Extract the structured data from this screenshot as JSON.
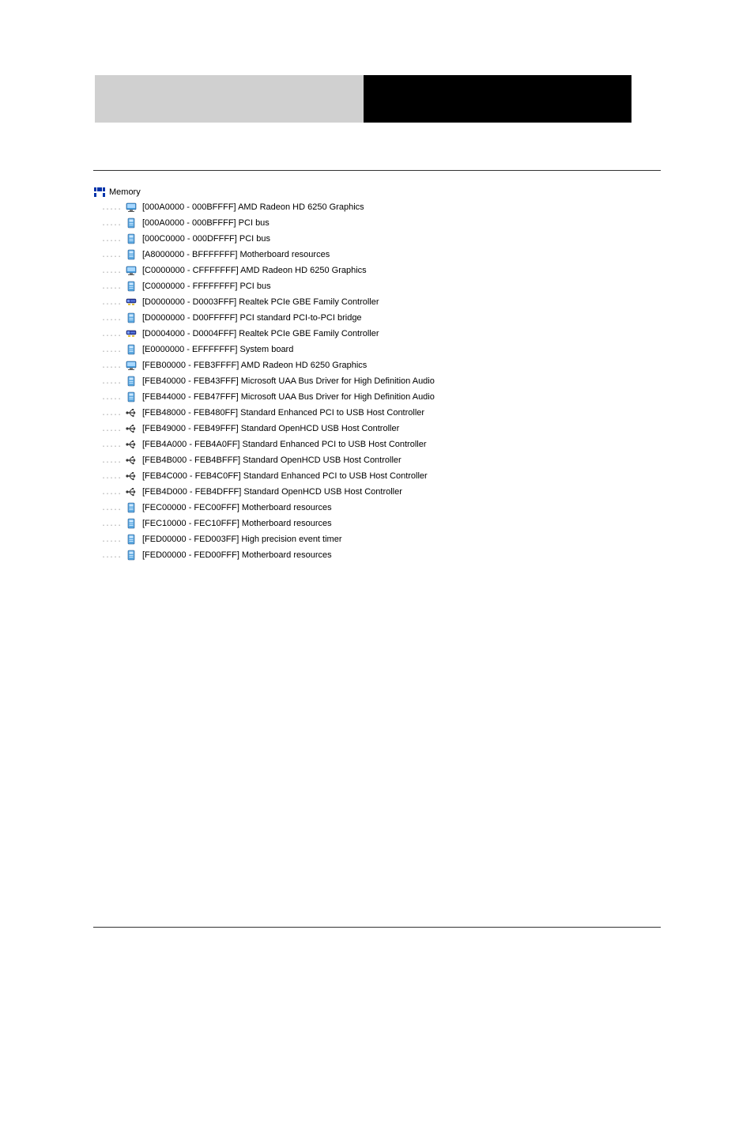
{
  "header": {
    "left": "",
    "right": ""
  },
  "tree": {
    "rootLabel": "Memory",
    "rootIcon": "memory-icon",
    "items": [
      {
        "icon": "display-icon",
        "text": "[000A0000 - 000BFFFF]  AMD Radeon HD 6250 Graphics"
      },
      {
        "icon": "system-icon",
        "text": "[000A0000 - 000BFFFF]  PCI bus"
      },
      {
        "icon": "system-icon",
        "text": "[000C0000 - 000DFFFF]  PCI bus"
      },
      {
        "icon": "system-icon",
        "text": "[A8000000 - BFFFFFFF]  Motherboard resources"
      },
      {
        "icon": "display-icon",
        "text": "[C0000000 - CFFFFFFF]  AMD Radeon HD 6250 Graphics"
      },
      {
        "icon": "system-icon",
        "text": "[C0000000 - FFFFFFFF]  PCI bus"
      },
      {
        "icon": "network-icon",
        "text": "[D0000000 - D0003FFF]  Realtek PCIe GBE Family Controller"
      },
      {
        "icon": "system-icon",
        "text": "[D0000000 - D00FFFFF]  PCI standard PCI-to-PCI bridge"
      },
      {
        "icon": "network-icon",
        "text": "[D0004000 - D0004FFF]  Realtek PCIe GBE Family Controller"
      },
      {
        "icon": "system-icon",
        "text": "[E0000000 - EFFFFFFF]  System board"
      },
      {
        "icon": "display-icon",
        "text": "[FEB00000 - FEB3FFFF]  AMD Radeon HD 6250 Graphics"
      },
      {
        "icon": "system-icon",
        "text": "[FEB40000 - FEB43FFF]  Microsoft UAA Bus Driver for High Definition Audio"
      },
      {
        "icon": "system-icon",
        "text": "[FEB44000 - FEB47FFF]  Microsoft UAA Bus Driver for High Definition Audio"
      },
      {
        "icon": "usb-icon",
        "text": "[FEB48000 - FEB480FF]  Standard Enhanced PCI to USB Host Controller"
      },
      {
        "icon": "usb-icon",
        "text": "[FEB49000 - FEB49FFF]  Standard OpenHCD USB Host Controller"
      },
      {
        "icon": "usb-icon",
        "text": "[FEB4A000 - FEB4A0FF]  Standard Enhanced PCI to USB Host Controller"
      },
      {
        "icon": "usb-icon",
        "text": "[FEB4B000 - FEB4BFFF]  Standard OpenHCD USB Host Controller"
      },
      {
        "icon": "usb-icon",
        "text": "[FEB4C000 - FEB4C0FF]  Standard Enhanced PCI to USB Host Controller"
      },
      {
        "icon": "usb-icon",
        "text": "[FEB4D000 - FEB4DFFF]  Standard OpenHCD USB Host Controller"
      },
      {
        "icon": "system-icon",
        "text": "[FEC00000 - FEC00FFF]  Motherboard resources"
      },
      {
        "icon": "system-icon",
        "text": "[FEC10000 - FEC10FFF]  Motherboard resources"
      },
      {
        "icon": "system-icon",
        "text": "[FED00000 - FED003FF]  High precision event timer"
      },
      {
        "icon": "system-icon",
        "text": "[FED00000 - FED00FFF]  Motherboard resources"
      }
    ]
  }
}
